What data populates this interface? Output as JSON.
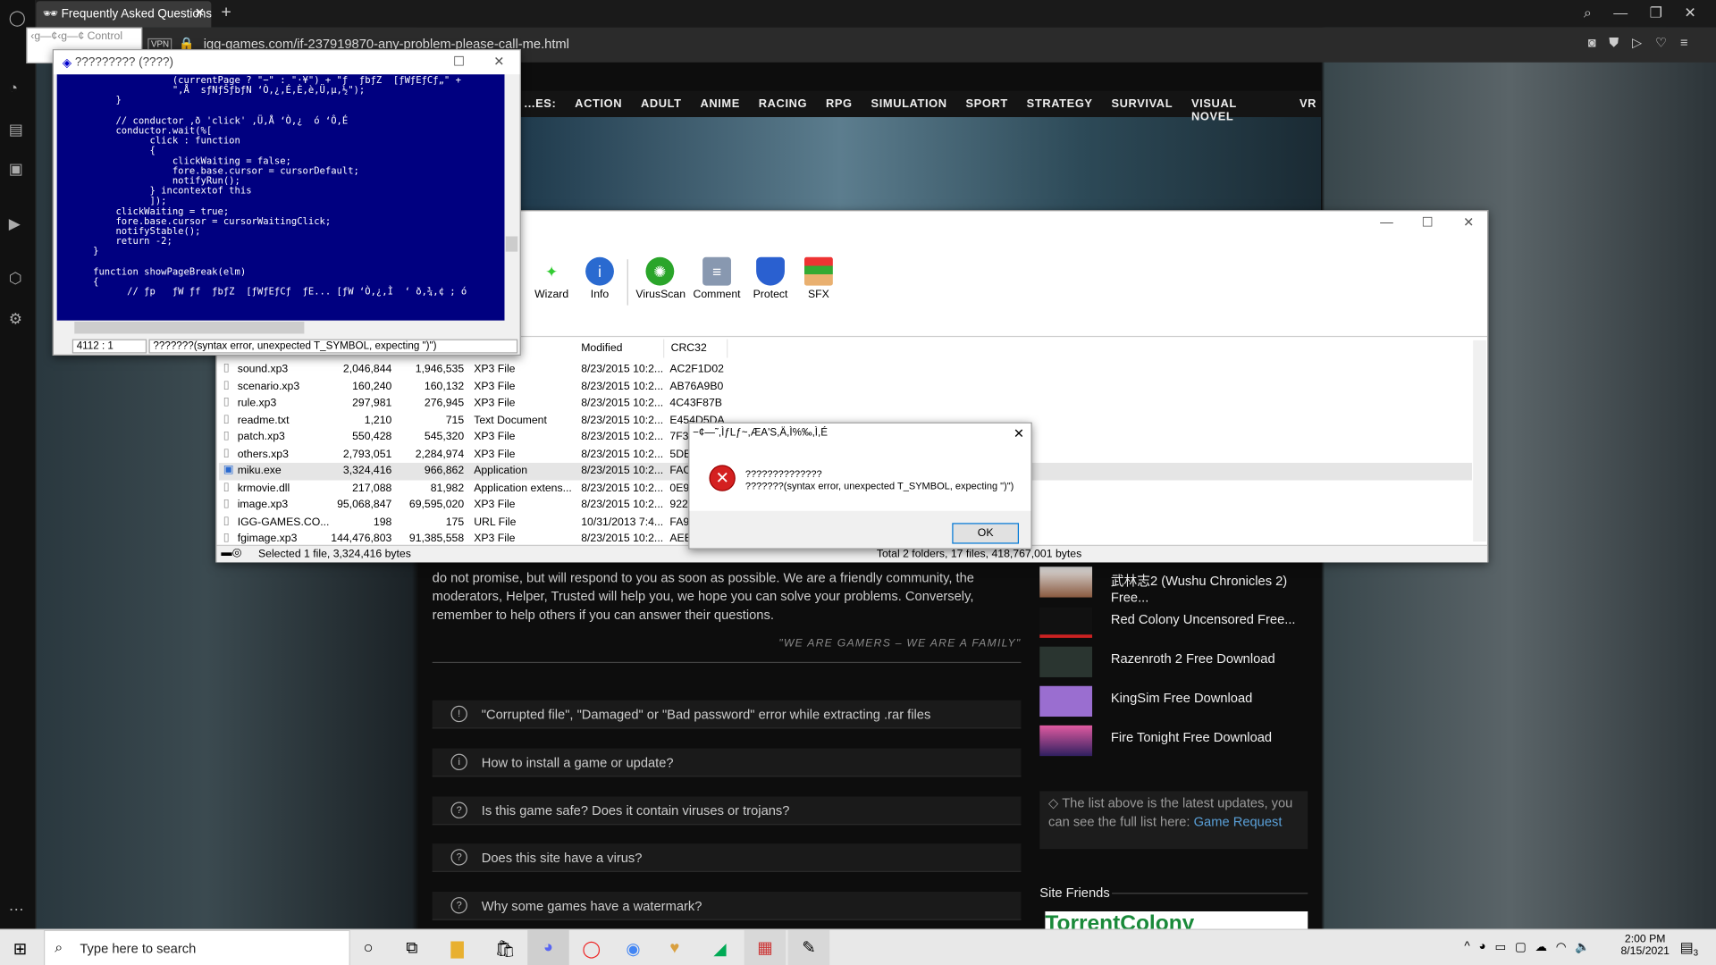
{
  "browser": {
    "tab_title": "Frequently Asked Questions",
    "url": "igg-games.com/if-237919870-any-problem-please-call-me.html",
    "vpn": "VPN",
    "control_window": "‹g—¢‹g—¢ Control"
  },
  "site": {
    "nav": [
      "...ES:",
      "ACTION",
      "ADULT",
      "ANIME",
      "RACING",
      "RPG",
      "SIMULATION",
      "SPORT",
      "STRATEGY",
      "SURVIVAL",
      "VISUAL NOVEL",
      "VR"
    ],
    "paragraph": "do not promise, but will respond to you as soon as possible. We are a friendly community, the moderators, Helper, Trusted will help you, we hope you can solve your problems. Conversely, remember to help others if you can answer their questions.",
    "quote": "\"WE ARE GAMERS – WE ARE A FAMILY\"",
    "faq": [
      {
        "icon": "!",
        "q": "\"Corrupted file\", \"Damaged\" or \"Bad password\" error while extracting .rar files"
      },
      {
        "icon": "i",
        "q": "How to install a game or update?"
      },
      {
        "icon": "?",
        "q": "Is this game safe? Does it contain viruses or trojans?"
      },
      {
        "icon": "?",
        "q": "Does this site have a virus?"
      },
      {
        "icon": "?",
        "q": "Why some games have a watermark?"
      }
    ],
    "latest": [
      "武林志2 (Wushu Chronicles 2) Free...",
      "Red Colony Uncensored Free...",
      "Razenroth 2 Free Download",
      "KingSim Free Download",
      "Fire Tonight Free Download"
    ],
    "info_text": "The list above is the latest updates, you can see the full list here:",
    "info_link": "Game Request",
    "site_friends": "Site Friends",
    "friend_logo": "TorrentColony"
  },
  "editor": {
    "title": "????????? (????)",
    "code": "                    (currentPage ? \"−\" : \"·¥\") + \"ƒ  ƒbƒZ  [ƒWƒEƒCƒ„\" +\n                    \",Å  sƒNƒŠƒbƒN ‘Ò,¿,É,È,è,Ü,µ,½\");\n          }\n\n          // conductor ,ð 'click' ,Ü,Å ‘Ò,¿  ó ‘Ô,É\n          conductor.wait(%[\n                click : function\n                {\n                    clickWaiting = false;\n                    fore.base.cursor = cursorDefault;\n                    notifyRun();\n                } incontextof this\n                ]);\n          clickWaiting = true;\n          fore.base.cursor = cursorWaitingClick;\n          notifyStable();\n          return -2;\n      }\n\n      function showPageBreak(elm)\n      {\n            // ƒp   ƒW ƒf  ƒbƒZ  [ƒWƒEƒCƒ  ƒE... [ƒW ‘Ò,¿,Ì  ‘ ð‚¾,¢ ; ó",
    "position": "4112 : 1",
    "error": "???????(syntax error, unexpected T_SYMBOL, expecting \")\")"
  },
  "archive": {
    "toolbar": [
      "Wizard",
      "Info",
      "VirusScan",
      "Comment",
      "Protect",
      "SFX"
    ],
    "columns": [
      "Modified",
      "CRC32"
    ],
    "files": [
      [
        "sound.xp3",
        "2,046,844",
        "1,946,535",
        "XP3 File",
        "8/23/2015 10:2...",
        "AC2F1D02"
      ],
      [
        "scenario.xp3",
        "160,240",
        "160,132",
        "XP3 File",
        "8/23/2015 10:2...",
        "AB76A9B0"
      ],
      [
        "rule.xp3",
        "297,981",
        "276,945",
        "XP3 File",
        "8/23/2015 10:2...",
        "4C43F87B"
      ],
      [
        "readme.txt",
        "1,210",
        "715",
        "Text Document",
        "8/23/2015 10:2...",
        "E454D5DA"
      ],
      [
        "patch.xp3",
        "550,428",
        "545,320",
        "XP3 File",
        "8/23/2015 10:2...",
        "7F3"
      ],
      [
        "others.xp3",
        "2,793,051",
        "2,284,974",
        "XP3 File",
        "8/23/2015 10:2...",
        "5DE"
      ],
      [
        "miku.exe",
        "3,324,416",
        "966,862",
        "Application",
        "8/23/2015 10:2...",
        "FAC"
      ],
      [
        "krmovie.dll",
        "217,088",
        "81,982",
        "Application extens...",
        "8/23/2015 10:2...",
        "0E9"
      ],
      [
        "image.xp3",
        "95,068,847",
        "69,595,020",
        "XP3 File",
        "8/23/2015 10:2...",
        "922"
      ],
      [
        "IGG-GAMES.CO...",
        "198",
        "175",
        "URL File",
        "10/31/2013 7:4...",
        "FA9"
      ],
      [
        "fgimage.xp3",
        "144,476,803",
        "91,385,558",
        "XP3 File",
        "8/23/2015 10:2...",
        "AEE"
      ]
    ],
    "status_left": "Selected 1 file, 3,324,416 bytes",
    "status_right": "Total 2 folders, 17 files, 418,767,001 bytes"
  },
  "dialog": {
    "title": "−¢—˜,ÌƒLƒ~,ÆA'S,Ä,Ì%‰,Ì,É",
    "line1": "??????????????",
    "line2": "???????(syntax error, unexpected T_SYMBOL, expecting \")\")",
    "ok": "OK"
  },
  "taskbar": {
    "search_placeholder": "Type here to search",
    "time": "2:00 PM",
    "date": "8/15/2021",
    "notifications": "3"
  }
}
